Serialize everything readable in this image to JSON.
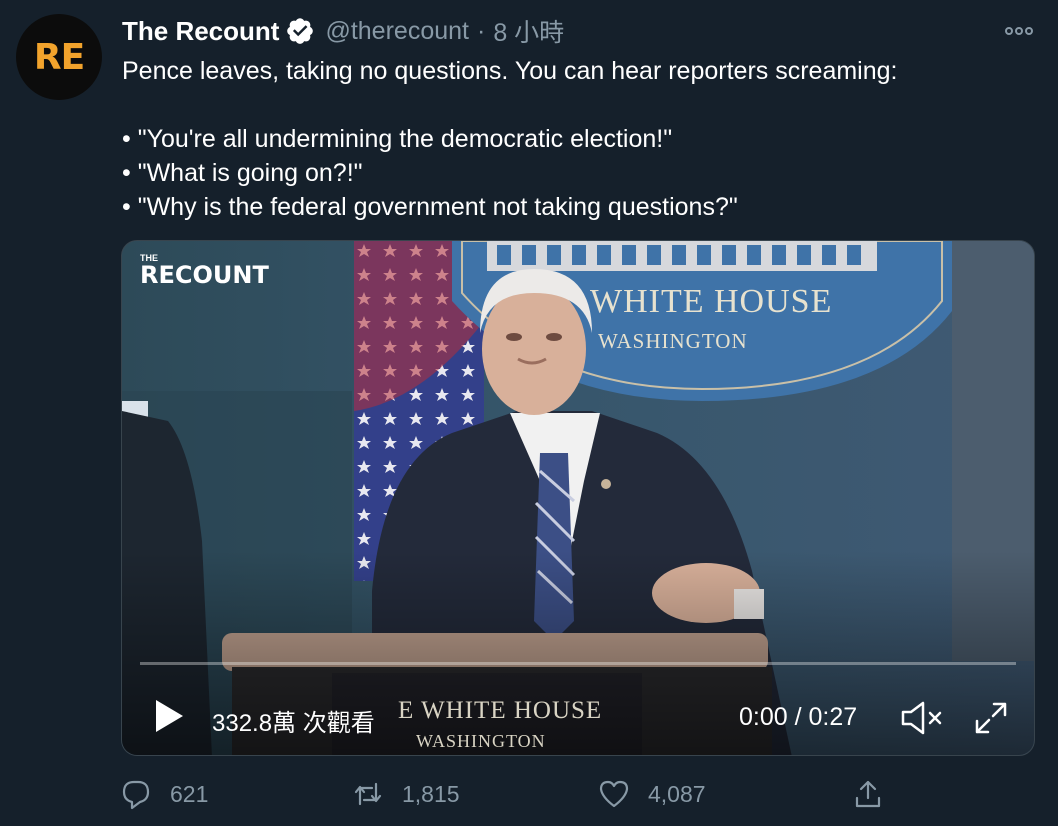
{
  "avatar": {
    "text": "RE",
    "color": "#f2a32c"
  },
  "header": {
    "display_name": "The Recount",
    "verified_icon": "verified-badge-icon",
    "handle": "@therecount",
    "separator": "·",
    "timestamp": "8 小時",
    "more_icon": "more-options-icon"
  },
  "tweet": {
    "line1": "Pence leaves, taking no questions. You can hear reporters screaming:",
    "bullets": [
      "• \"You're all undermining the democratic election!\"",
      "• \"What is going on?!\"",
      "• \"Why is the federal government not taking questions?\""
    ]
  },
  "video": {
    "brand_small": "THE",
    "brand_big": "RECOUNT",
    "seal_text": "WHITE HOUSE",
    "seal_subtext": "WASHINGTON",
    "podium_text": "E WHITE HOUSE",
    "podium_subtext": "WASHINGTON",
    "views": "332.8萬 次觀看",
    "time": "0:00 / 0:27",
    "progress": 0.0,
    "play_icon": "play-icon",
    "mute_icon": "muted-speaker-icon",
    "fullscreen_icon": "fullscreen-icon"
  },
  "actions": {
    "reply_count": "621",
    "retweet_count": "1,815",
    "like_count": "4,087"
  },
  "colors": {
    "background": "#15202b",
    "secondary_text": "#8899a6",
    "border": "#38444d",
    "verified": "#ffffff"
  }
}
